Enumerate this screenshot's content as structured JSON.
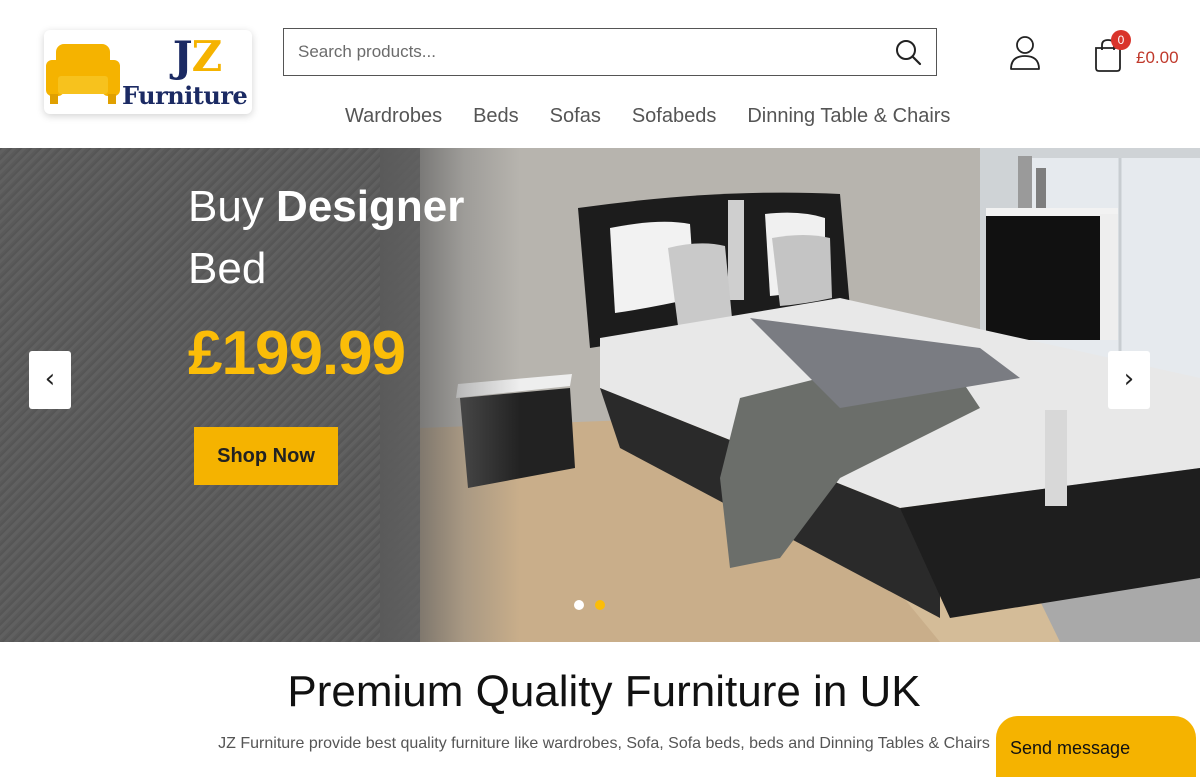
{
  "logo": {
    "line1_j": "J",
    "line1_z": "Z",
    "line2": "Furniture"
  },
  "search": {
    "placeholder": "Search products..."
  },
  "nav": {
    "items": [
      "Wardrobes",
      "Beds",
      "Sofas",
      "Sofabeds",
      "Dinning Table & Chairs"
    ]
  },
  "cart": {
    "count": "0",
    "total": "£0.00"
  },
  "hero": {
    "title_regular": "Buy ",
    "title_bold": "Designer",
    "title_line2": "Bed",
    "price": "£199.99",
    "cta_label": "Shop Now",
    "prev_arrow": "‹",
    "next_arrow": "›",
    "slides": 2,
    "active_slide": 2
  },
  "intro": {
    "title": "Premium Quality Furniture in UK",
    "text": "JZ Furniture provide best quality furniture like wardrobes, Sofa, Sofa beds, beds and Dinning Tables & Chairs"
  },
  "chat": {
    "label": "Send message"
  },
  "colors": {
    "brand_yellow": "#f5b300",
    "brand_navy": "#1b2a63",
    "cart_badge": "#d9342b",
    "price_yellow": "#fbbd08"
  }
}
